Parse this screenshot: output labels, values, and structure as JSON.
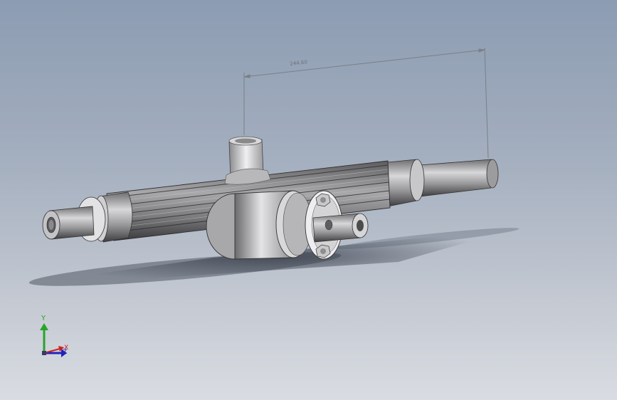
{
  "viewport": {
    "background_top": "#8c9cb2",
    "background_bottom": "#d9dce2"
  },
  "dimension": {
    "value_text": "244.60"
  },
  "model": {
    "body_color": "#8a8a8c",
    "metal_light": "#e6e6e8",
    "metal_dark": "#4a4a4c"
  },
  "triad": {
    "y_label": "Y",
    "x_label": "X",
    "z_label": "Z",
    "y_color": "#29a329",
    "x_color": "#cc2222",
    "z_color": "#2222bb"
  }
}
